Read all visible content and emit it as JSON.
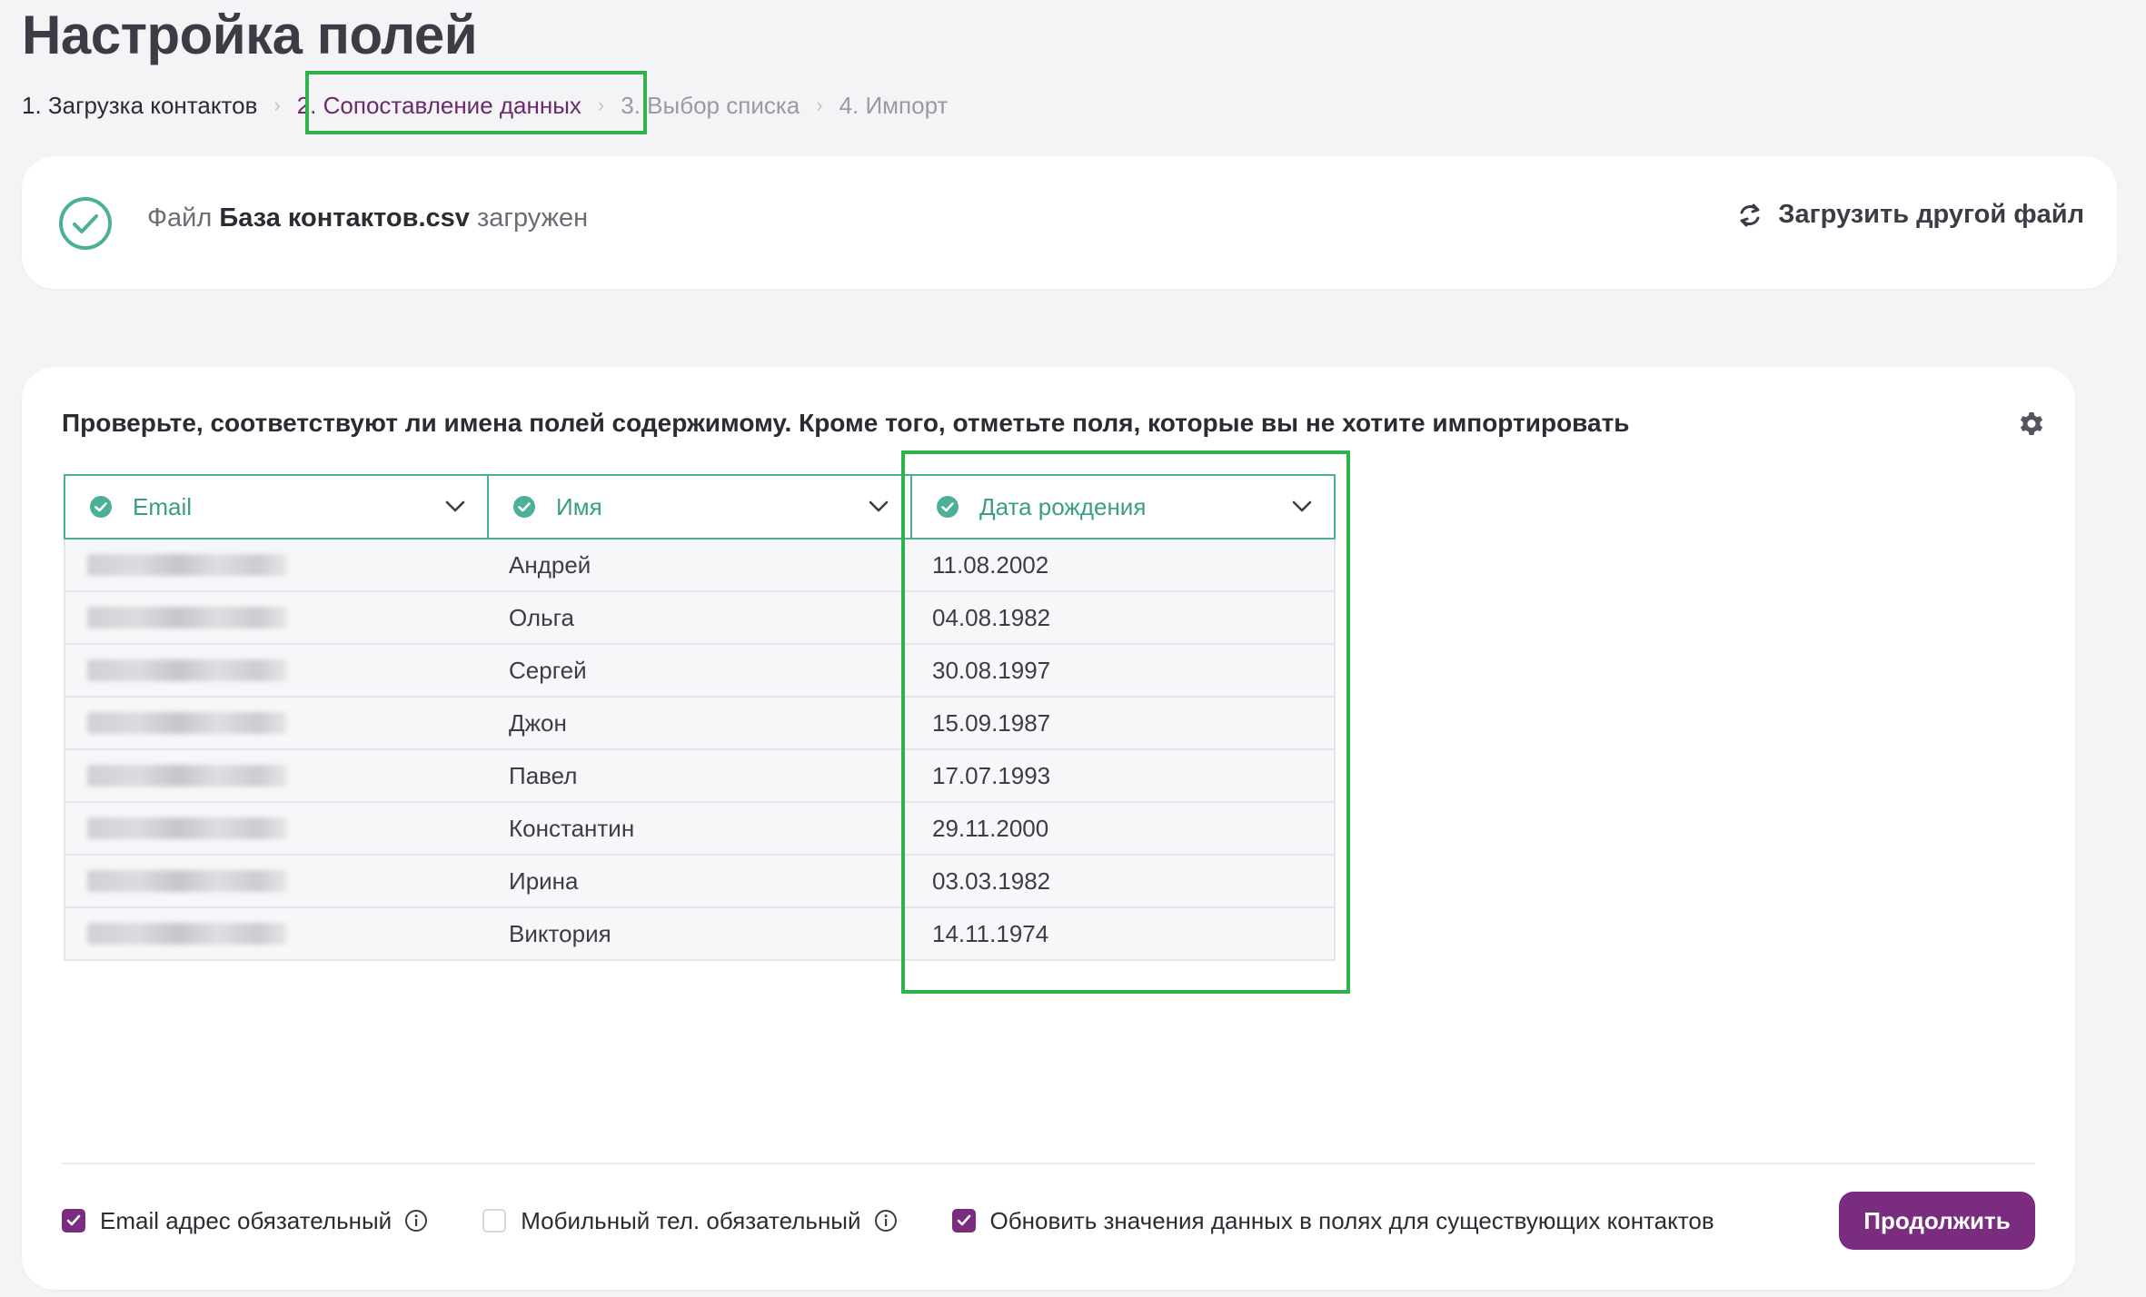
{
  "page_title": "Настройка полей",
  "steps": [
    {
      "label": "1. Загрузка контактов",
      "state": "done"
    },
    {
      "label": "2. Сопоставление данных",
      "state": "active"
    },
    {
      "label": "3. Выбор списка",
      "state": "todo"
    },
    {
      "label": "4. Импорт",
      "state": "todo"
    }
  ],
  "step_separator": "›",
  "file_status": {
    "prefix": "Файл",
    "filename": "База контактов.csv",
    "suffix": "загружен",
    "reload_label": "Загрузить другой файл"
  },
  "mapping": {
    "instruction": "Проверьте, соответствуют ли имена полей содержимому. Кроме того, отметьте поля, которые вы не хотите импортировать",
    "columns": [
      {
        "label": "Email"
      },
      {
        "label": "Имя"
      },
      {
        "label": "Дата рождения"
      }
    ],
    "rows": [
      {
        "name": "Андрей",
        "birthdate": "11.08.2002"
      },
      {
        "name": "Ольга",
        "birthdate": "04.08.1982"
      },
      {
        "name": "Сергей",
        "birthdate": "30.08.1997"
      },
      {
        "name": "Джон",
        "birthdate": "15.09.1987"
      },
      {
        "name": "Павел",
        "birthdate": "17.07.1993"
      },
      {
        "name": "Константин",
        "birthdate": "29.11.2000"
      },
      {
        "name": "Ирина",
        "birthdate": "03.03.1982"
      },
      {
        "name": "Виктория",
        "birthdate": "14.11.1974"
      }
    ]
  },
  "options": {
    "email_required": {
      "label": "Email адрес обязательный",
      "checked": true
    },
    "phone_required": {
      "label": "Мобильный тел. обязательный",
      "checked": false
    },
    "update_existing": {
      "label": "Обновить значения данных в полях для существующих контактов",
      "checked": true
    }
  },
  "continue_label": "Продолжить",
  "colors": {
    "accent": "#7a2d7e",
    "teal": "#4caf97",
    "highlight": "#2db34a"
  }
}
